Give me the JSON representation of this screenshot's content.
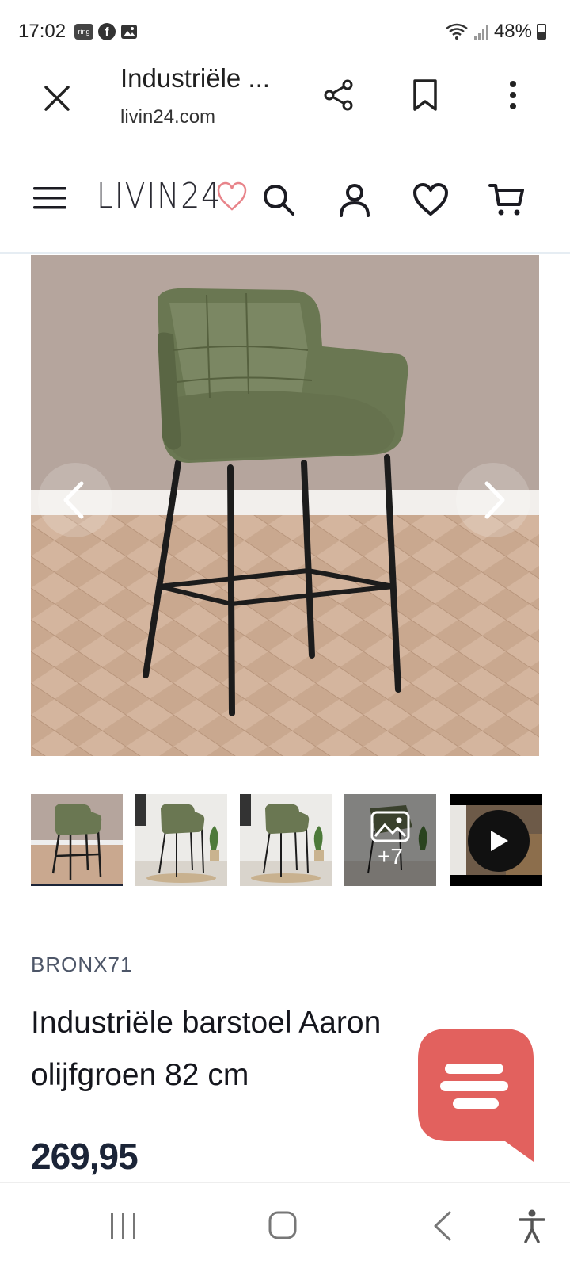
{
  "status_bar": {
    "time": "17:02",
    "ring_label": "ring",
    "facebook_label": "f",
    "battery": "48%"
  },
  "browser": {
    "title": "Industriële ...",
    "url": "livin24.com",
    "icons": [
      "close-icon",
      "share-icon",
      "bookmark-icon",
      "more-vert-icon"
    ]
  },
  "site_header": {
    "logo_text": "LIVIN24",
    "icons": [
      "menu-icon",
      "search-icon",
      "user-icon",
      "heart-icon",
      "cart-icon"
    ]
  },
  "gallery": {
    "images_label_more": "+7"
  },
  "product": {
    "sku": "BRONX71",
    "title": "Industriële barstoel Aaron olijfgroen 82 cm",
    "price": "269,95"
  },
  "colors": {
    "accent": "#e2615e",
    "text_dark": "#1b2437",
    "sku_grey": "#4d5668",
    "logo_heart": "#e8848a"
  }
}
